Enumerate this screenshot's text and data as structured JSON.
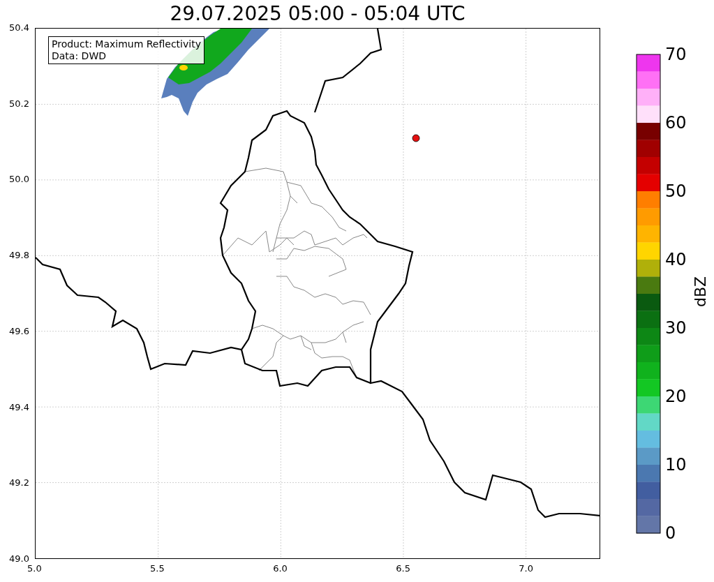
{
  "title": "29.07.2025 05:00 - 05:04 UTC",
  "legend": [
    "Product: Maximum Reflectivity",
    "Data: DWD"
  ],
  "x_ticks": [
    "5.0",
    "5.5",
    "6.0",
    "6.5",
    "7.0"
  ],
  "y_ticks": [
    "50.4",
    "50.2",
    "50.0",
    "49.8",
    "49.6",
    "49.4",
    "49.2",
    "49.0"
  ],
  "colorbar": {
    "label": "dBZ",
    "ticks": [
      "70",
      "60",
      "50",
      "40",
      "30",
      "20",
      "10",
      "0"
    ],
    "bands": [
      {
        "color": "#ee36ee"
      },
      {
        "color": "#ff70f5"
      },
      {
        "color": "#ffb0f8"
      },
      {
        "color": "#ffe0fa"
      },
      {
        "color": "#780000"
      },
      {
        "color": "#a00000"
      },
      {
        "color": "#c40000"
      },
      {
        "color": "#e40000"
      },
      {
        "color": "#ff7e00"
      },
      {
        "color": "#ff9b00"
      },
      {
        "color": "#ffb400"
      },
      {
        "color": "#ffd500"
      },
      {
        "color": "#b0b00a"
      },
      {
        "color": "#4a7a10"
      },
      {
        "color": "#0a5a10"
      },
      {
        "color": "#0b7012"
      },
      {
        "color": "#0d8715"
      },
      {
        "color": "#0f9d19"
      },
      {
        "color": "#10b21d"
      },
      {
        "color": "#13c723"
      },
      {
        "color": "#3dd774"
      },
      {
        "color": "#62d8c6"
      },
      {
        "color": "#64bde0"
      },
      {
        "color": "#5b9ac6"
      },
      {
        "color": "#4b78b0"
      },
      {
        "color": "#425ea0"
      },
      {
        "color": "#5468a3"
      },
      {
        "color": "#6376a8"
      }
    ]
  }
}
